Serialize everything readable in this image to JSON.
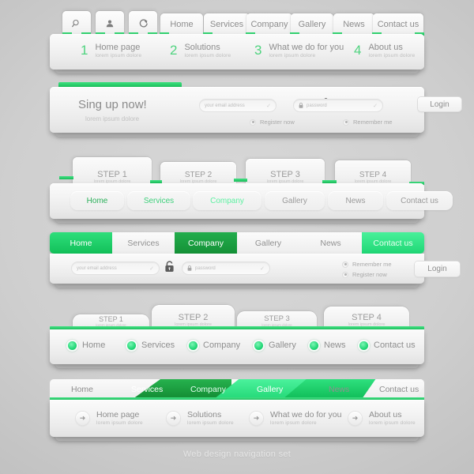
{
  "footer": {
    "caption": "Web design navigation set"
  },
  "colors": {
    "green_light": "#3ddc7a",
    "green": "#16c35f",
    "green_dark": "#1a9e3e",
    "green_pale": "#48f09a",
    "text_gray": "#8d8d8d",
    "text_light": "#bdbdbd"
  },
  "row1": {
    "icon_tabs": [
      {
        "name": "search-icon",
        "glyph": "search"
      },
      {
        "name": "user-icon",
        "glyph": "user"
      },
      {
        "name": "refresh-icon",
        "glyph": "refresh"
      }
    ],
    "nav": [
      {
        "label": "Home"
      },
      {
        "label": "Services"
      },
      {
        "label": "Company"
      },
      {
        "label": "Gallery"
      },
      {
        "label": "News"
      },
      {
        "label": "Contact us"
      }
    ],
    "items": [
      {
        "num": "1",
        "title": "Home page",
        "sub": "lorem ipsum dolore"
      },
      {
        "num": "2",
        "title": "Solutions",
        "sub": "lorem ipsum dolore"
      },
      {
        "num": "3",
        "title": "What we do for you",
        "sub": "lorem ipsum dolore"
      },
      {
        "num": "4",
        "title": "About us",
        "sub": "lorem ipsum dolore"
      }
    ]
  },
  "row2": {
    "headline": "Sing up now!",
    "subline": "lorem ipsum dolore",
    "email": {
      "placeholder": "your email address",
      "value": ""
    },
    "password": {
      "placeholder": "password",
      "value": ""
    },
    "lock_icon": "lock-icon",
    "login_label": "Login",
    "radios": [
      {
        "label": "Register now"
      },
      {
        "label": "Remember me"
      }
    ]
  },
  "row3": {
    "steps": [
      {
        "title": "STEP 1",
        "sub": "lorem ipsum dolore"
      },
      {
        "title": "STEP 2",
        "sub": "lorem ipsum dolore"
      },
      {
        "title": "STEP 3",
        "sub": "lorem ipsum dolore"
      },
      {
        "title": "STEP 4",
        "sub": "lorem ipsum dolore"
      }
    ],
    "nav": [
      {
        "label": "Home",
        "color": "#2bb05a"
      },
      {
        "label": "Services",
        "color": "#3fd07c"
      },
      {
        "label": "Company",
        "color": "#5ef0a2"
      },
      {
        "label": "Gallery",
        "color": "#9a9a9a"
      },
      {
        "label": "News",
        "color": "#9a9a9a"
      },
      {
        "label": "Contact us",
        "color": "#9a9a9a"
      }
    ]
  },
  "row4": {
    "nav": [
      {
        "label": "Home",
        "state": "green"
      },
      {
        "label": "Services",
        "state": "plain"
      },
      {
        "label": "Company",
        "state": "green-dark"
      },
      {
        "label": "Gallery",
        "state": "plain"
      },
      {
        "label": "News",
        "state": "plain"
      },
      {
        "label": "Contact us",
        "state": "green-light"
      }
    ],
    "email": {
      "placeholder": "your email address",
      "value": ""
    },
    "password": {
      "placeholder": "password",
      "value": ""
    },
    "lock_icon": "unlock-icon",
    "login_label": "Login",
    "radios": [
      {
        "label": "Remember me"
      },
      {
        "label": "Register now"
      }
    ]
  },
  "row5": {
    "steps": [
      {
        "title": "STEP 1",
        "sub": "lorem ipsum dolore"
      },
      {
        "title": "STEP 2",
        "sub": "lorem ipsum dolore"
      },
      {
        "title": "STEP 3",
        "sub": "lorem ipsum dolore"
      },
      {
        "title": "STEP 4",
        "sub": "lorem ipsum dolore"
      }
    ],
    "nav": [
      {
        "label": "Home"
      },
      {
        "label": "Services"
      },
      {
        "label": "Company"
      },
      {
        "label": "Gallery"
      },
      {
        "label": "News"
      },
      {
        "label": "Contact us"
      }
    ]
  },
  "row6": {
    "nav": [
      {
        "label": "Home",
        "state": "plain"
      },
      {
        "label": "Services",
        "state": "green-dark"
      },
      {
        "label": "Company",
        "state": "green-light"
      },
      {
        "label": "Gallery",
        "state": "green"
      },
      {
        "label": "News",
        "state": "plain"
      },
      {
        "label": "Contact us",
        "state": "plain"
      }
    ],
    "items": [
      {
        "title": "Home page",
        "sub": "lorem ipsum dolore",
        "icon": "arrow-right-icon"
      },
      {
        "title": "Solutions",
        "sub": "lorem ipsum dolore",
        "icon": "arrow-right-icon"
      },
      {
        "title": "What we do for you",
        "sub": "lorem ipsum dolore",
        "icon": "arrow-right-icon"
      },
      {
        "title": "About us",
        "sub": "lorem ipsum dolore",
        "icon": "arrow-right-icon"
      }
    ]
  }
}
